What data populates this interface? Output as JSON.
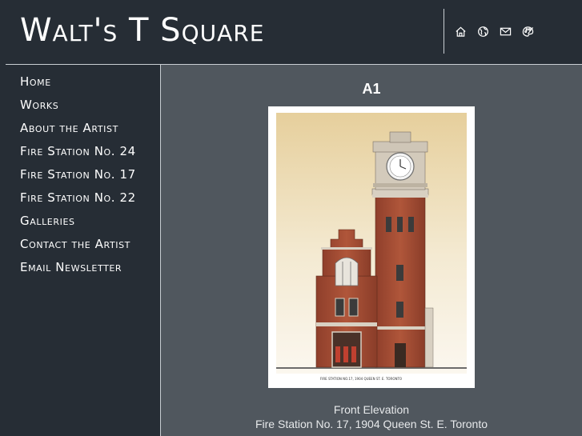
{
  "site": {
    "title": "Walt's T Square"
  },
  "header_icons": [
    {
      "name": "home-icon"
    },
    {
      "name": "globe-icon"
    },
    {
      "name": "mail-icon"
    },
    {
      "name": "palette-icon"
    }
  ],
  "nav": [
    {
      "label": "Home"
    },
    {
      "label": "Works"
    },
    {
      "label": "About the Artist"
    },
    {
      "label": "Fire Station No. 24"
    },
    {
      "label": "Fire Station No. 17"
    },
    {
      "label": "Fire Station No. 22"
    },
    {
      "label": "Galleries"
    },
    {
      "label": "Contact the Artist"
    },
    {
      "label": "Email Newsletter"
    }
  ],
  "artwork": {
    "title": "A1",
    "inscription": "FIRE STATION NO.17, 1904 QUEEN ST. E. TORONTO",
    "caption_line1": "Front Elevation",
    "caption_line2": "Fire Station No. 17, 1904 Queen St. E. Toronto"
  },
  "colors": {
    "background": "#262d35",
    "content": "#50575e",
    "divider": "#c9ced3",
    "brick": "#a64b32"
  }
}
